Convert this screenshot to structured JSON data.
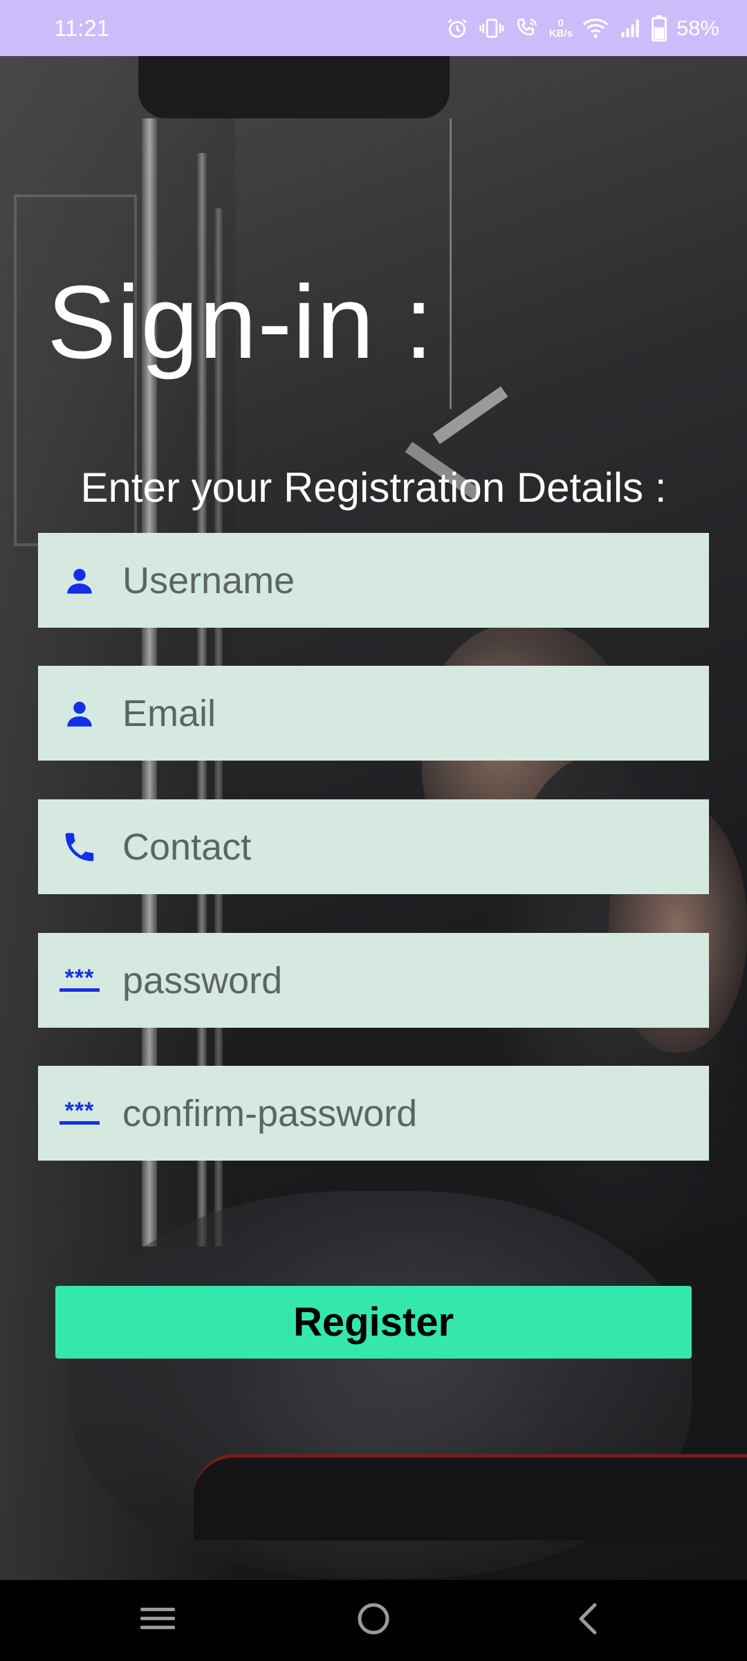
{
  "status_bar": {
    "time": "11:21",
    "net_speed_value": "0",
    "net_speed_unit": "KB/s",
    "battery_percent": "58%",
    "icons": [
      "alarm-icon",
      "vibrate-icon",
      "wifi-call-icon",
      "net-speed-indicator",
      "wifi-icon",
      "signal-icon",
      "battery-icon"
    ]
  },
  "page": {
    "title": "Sign-in :",
    "subtitle": "Enter your Registration Details :"
  },
  "form": {
    "fields": [
      {
        "name": "username",
        "placeholder": "Username",
        "value": "",
        "icon": "person-icon"
      },
      {
        "name": "email",
        "placeholder": "Email",
        "value": "",
        "icon": "person-icon"
      },
      {
        "name": "contact",
        "placeholder": "Contact",
        "value": "",
        "icon": "phone-icon"
      },
      {
        "name": "password",
        "placeholder": "password",
        "value": "",
        "icon": "password-icon",
        "icon_text": "***"
      },
      {
        "name": "confirm-password",
        "placeholder": "confirm-password",
        "value": "",
        "icon": "password-icon",
        "icon_text": "***"
      }
    ],
    "register_label": "Register"
  },
  "nav_bar": {
    "buttons": [
      "menu-icon",
      "home-icon",
      "back-icon"
    ]
  },
  "colors": {
    "status_bar_bg": "#cdbcfa",
    "field_bg": "#d5e9e1",
    "icon_blue": "#1230e6",
    "button_bg": "#34e8ad",
    "nav_bar_bg": "#000000"
  }
}
